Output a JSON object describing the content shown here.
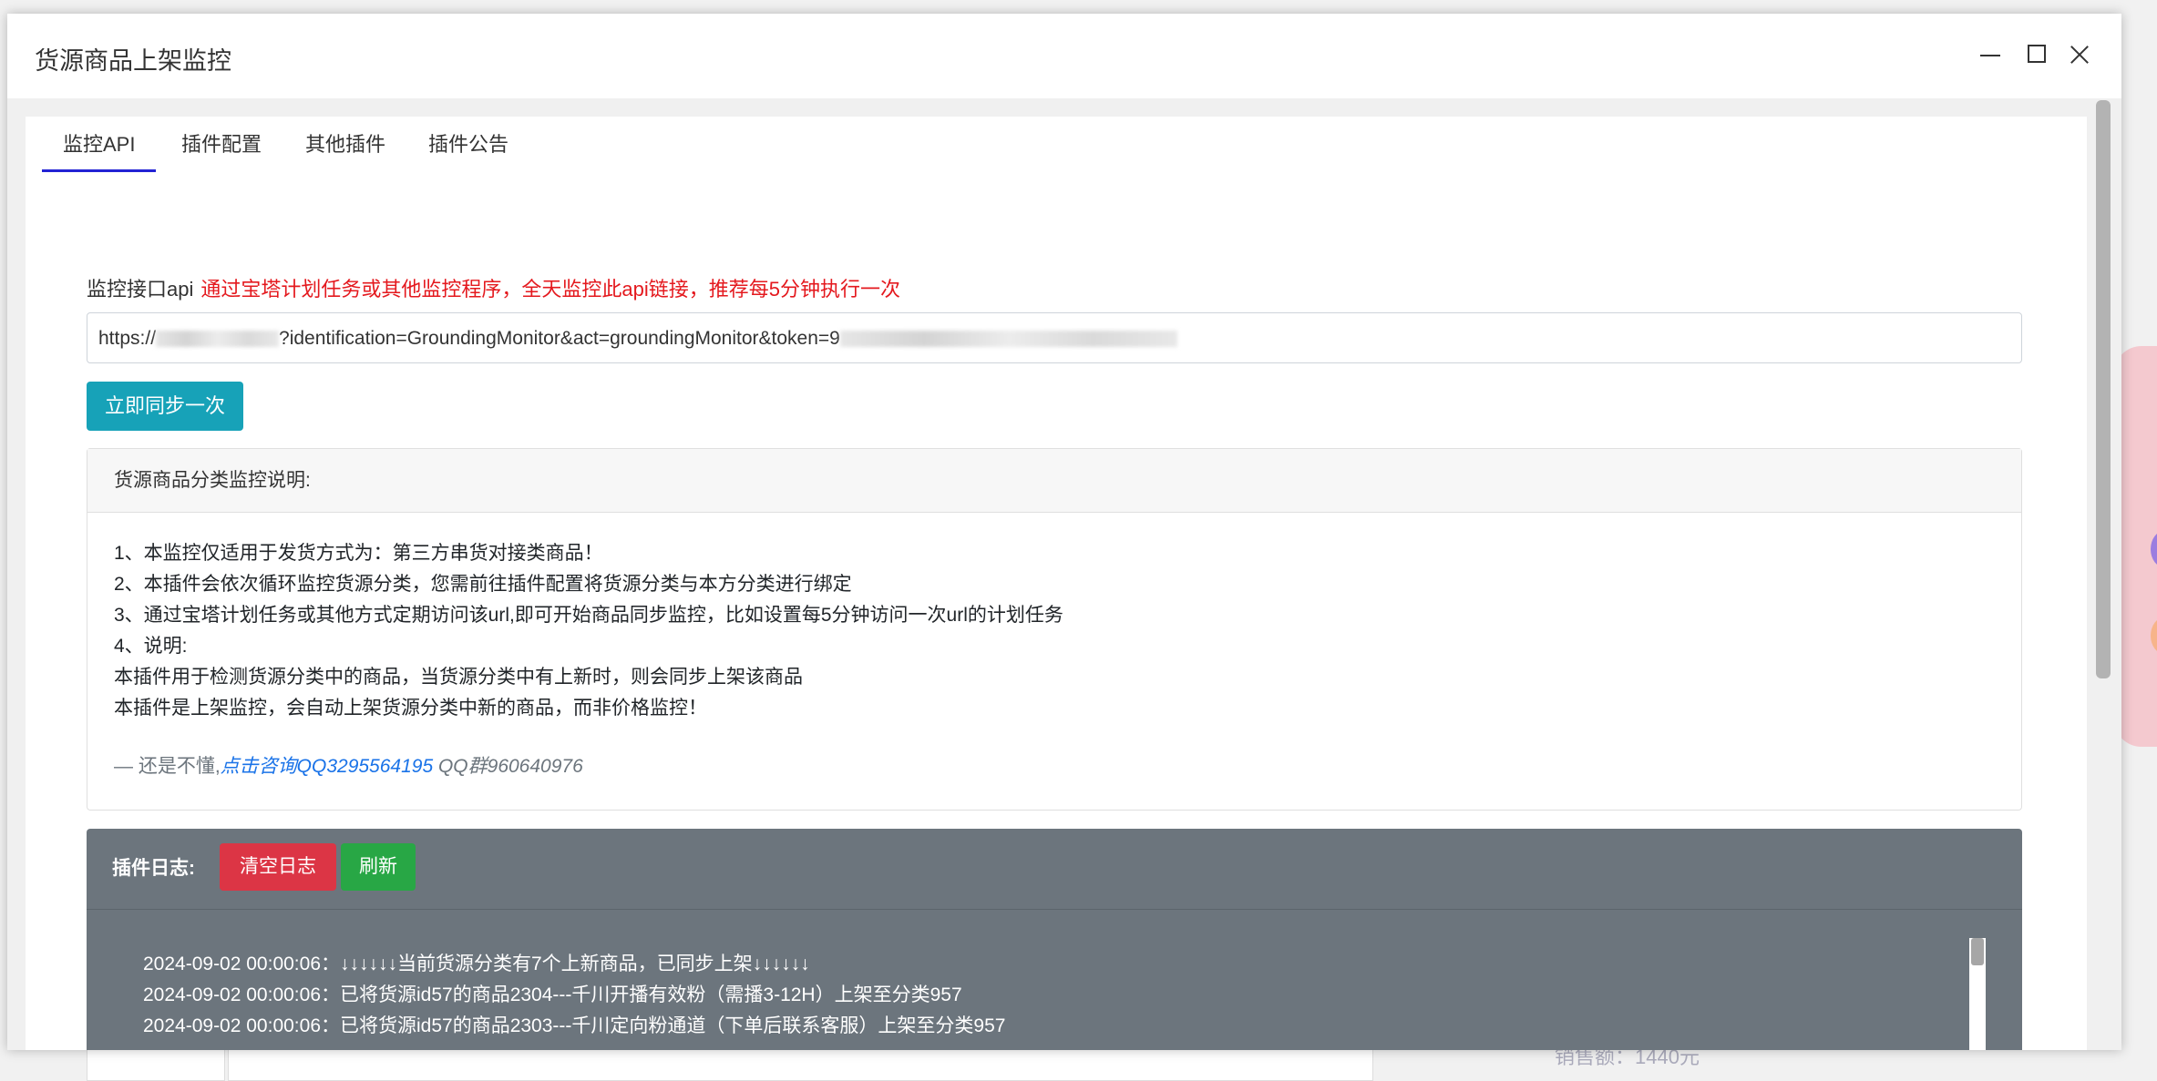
{
  "window": {
    "title": "货源商品上架监控",
    "controls": [
      "minimize-icon",
      "maximize-icon",
      "close-icon"
    ]
  },
  "tabs": [
    {
      "label": "监控API",
      "active": true
    },
    {
      "label": "插件配置",
      "active": false
    },
    {
      "label": "其他插件",
      "active": false
    },
    {
      "label": "插件公告",
      "active": false
    }
  ],
  "api": {
    "label": "监控接口api",
    "note": "通过宝塔计划任务或其他监控程序，全天监控此api链接，推荐每5分钟执行一次",
    "url_prefix": "https://",
    "url_middle": "?identification=GroundingMonitor&act=groundingMonitor&token=",
    "url_tail": "9"
  },
  "sync_button": "立即同步一次",
  "info_card": {
    "header": "货源商品分类监控说明:",
    "lines": [
      "1、本监控仅适用于发货方式为：第三方串货对接类商品！",
      "2、本插件会依次循环监控货源分类，您需前往插件配置将货源分类与本方分类进行绑定",
      "3、通过宝塔计划任务或其他方式定期访问该url,即可开始商品同步监控，比如设置每5分钟访问一次url的计划任务",
      "4、说明:",
      "本插件用于检测货源分类中的商品，当货源分类中有上新时，则会同步上架该商品",
      "本插件是上架监控，会自动上架货源分类中新的商品，而非价格监控！"
    ],
    "footer_dash": "— 还是不懂,",
    "footer_link": "点击咨询QQ3295564195",
    "footer_group": " QQ群960640976"
  },
  "log": {
    "title": "插件日志:",
    "clear_button": "清空日志",
    "refresh_button": "刷新",
    "entries": [
      "2024-09-02 00:00:06：↓↓↓↓↓↓当前货源分类有7个上新商品，已同步上架↓↓↓↓↓↓",
      "2024-09-02 00:00:06：已将货源id57的商品2304---千川开播有效粉（需播3-12H）上架至分类957",
      "2024-09-02 00:00:06：已将货源id57的商品2303---千川定向粉通道（下单后联系客服）上架至分类957"
    ]
  },
  "background": {
    "sales_text": "销售额：1440元"
  },
  "colors": {
    "tab_active_underline": "#2323d4",
    "note_red": "#e4191e",
    "sync_button": "#17a2b8",
    "log_bg": "#6c757d",
    "clear_button": "#dc3545",
    "refresh_button": "#28a745",
    "link_blue": "#1a73e8"
  }
}
